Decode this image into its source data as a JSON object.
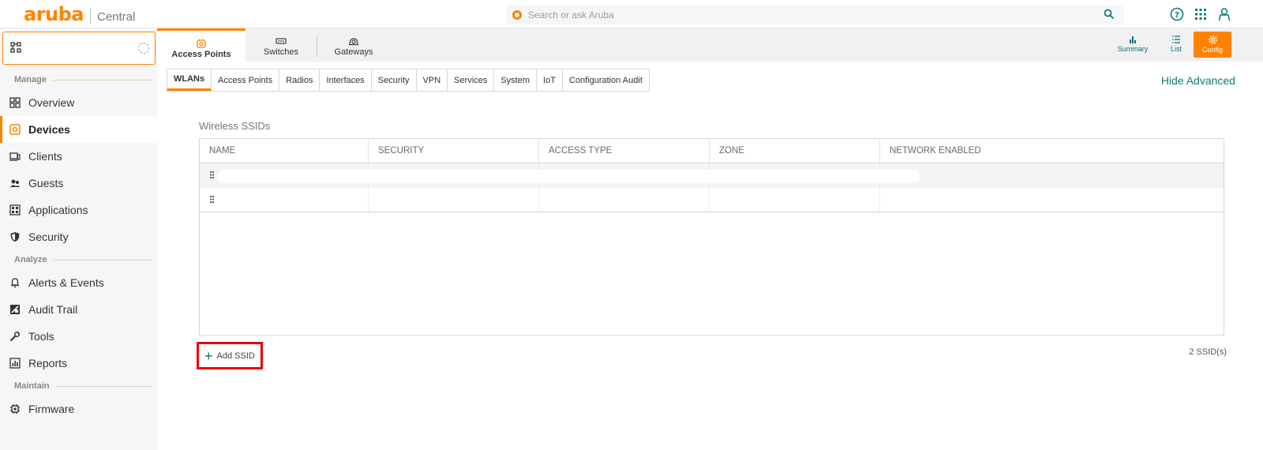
{
  "brand": {
    "logo": "aruba",
    "product": "Central"
  },
  "search": {
    "placeholder": "Search or ask Aruba"
  },
  "colors": {
    "accent": "#ff8300",
    "teal": "#0c7b73",
    "highlight": "#e8000b"
  },
  "sidebar": {
    "sections": [
      {
        "label": "Manage"
      },
      {
        "label": "Analyze"
      },
      {
        "label": "Maintain"
      }
    ],
    "items": [
      {
        "label": "Overview",
        "icon": "grid-icon"
      },
      {
        "label": "Devices",
        "icon": "devices-icon",
        "active": true
      },
      {
        "label": "Clients",
        "icon": "clients-icon"
      },
      {
        "label": "Guests",
        "icon": "guests-icon"
      },
      {
        "label": "Applications",
        "icon": "applications-icon"
      },
      {
        "label": "Security",
        "icon": "shield-icon"
      },
      {
        "label": "Alerts & Events",
        "icon": "bell-icon"
      },
      {
        "label": "Audit Trail",
        "icon": "audit-icon"
      },
      {
        "label": "Tools",
        "icon": "wrench-icon"
      },
      {
        "label": "Reports",
        "icon": "reports-icon"
      },
      {
        "label": "Firmware",
        "icon": "chip-icon"
      }
    ]
  },
  "device_tabs": [
    {
      "label": "Access Points",
      "active": true
    },
    {
      "label": "Switches"
    },
    {
      "label": "Gateways"
    }
  ],
  "view_buttons": [
    {
      "label": "Summary"
    },
    {
      "label": "List"
    },
    {
      "label": "Config",
      "active": true
    }
  ],
  "sub_tabs": [
    "WLANs",
    "Access Points",
    "Radios",
    "Interfaces",
    "Security",
    "VPN",
    "Services",
    "System",
    "IoT",
    "Configuration Audit"
  ],
  "hide_advanced": "Hide Advanced",
  "wireless": {
    "title": "Wireless SSIDs",
    "columns": [
      "NAME",
      "SECURITY",
      "ACCESS TYPE",
      "ZONE",
      "NETWORK ENABLED"
    ],
    "add_label": "Add SSID",
    "count_label": "2 SSID(s)"
  }
}
